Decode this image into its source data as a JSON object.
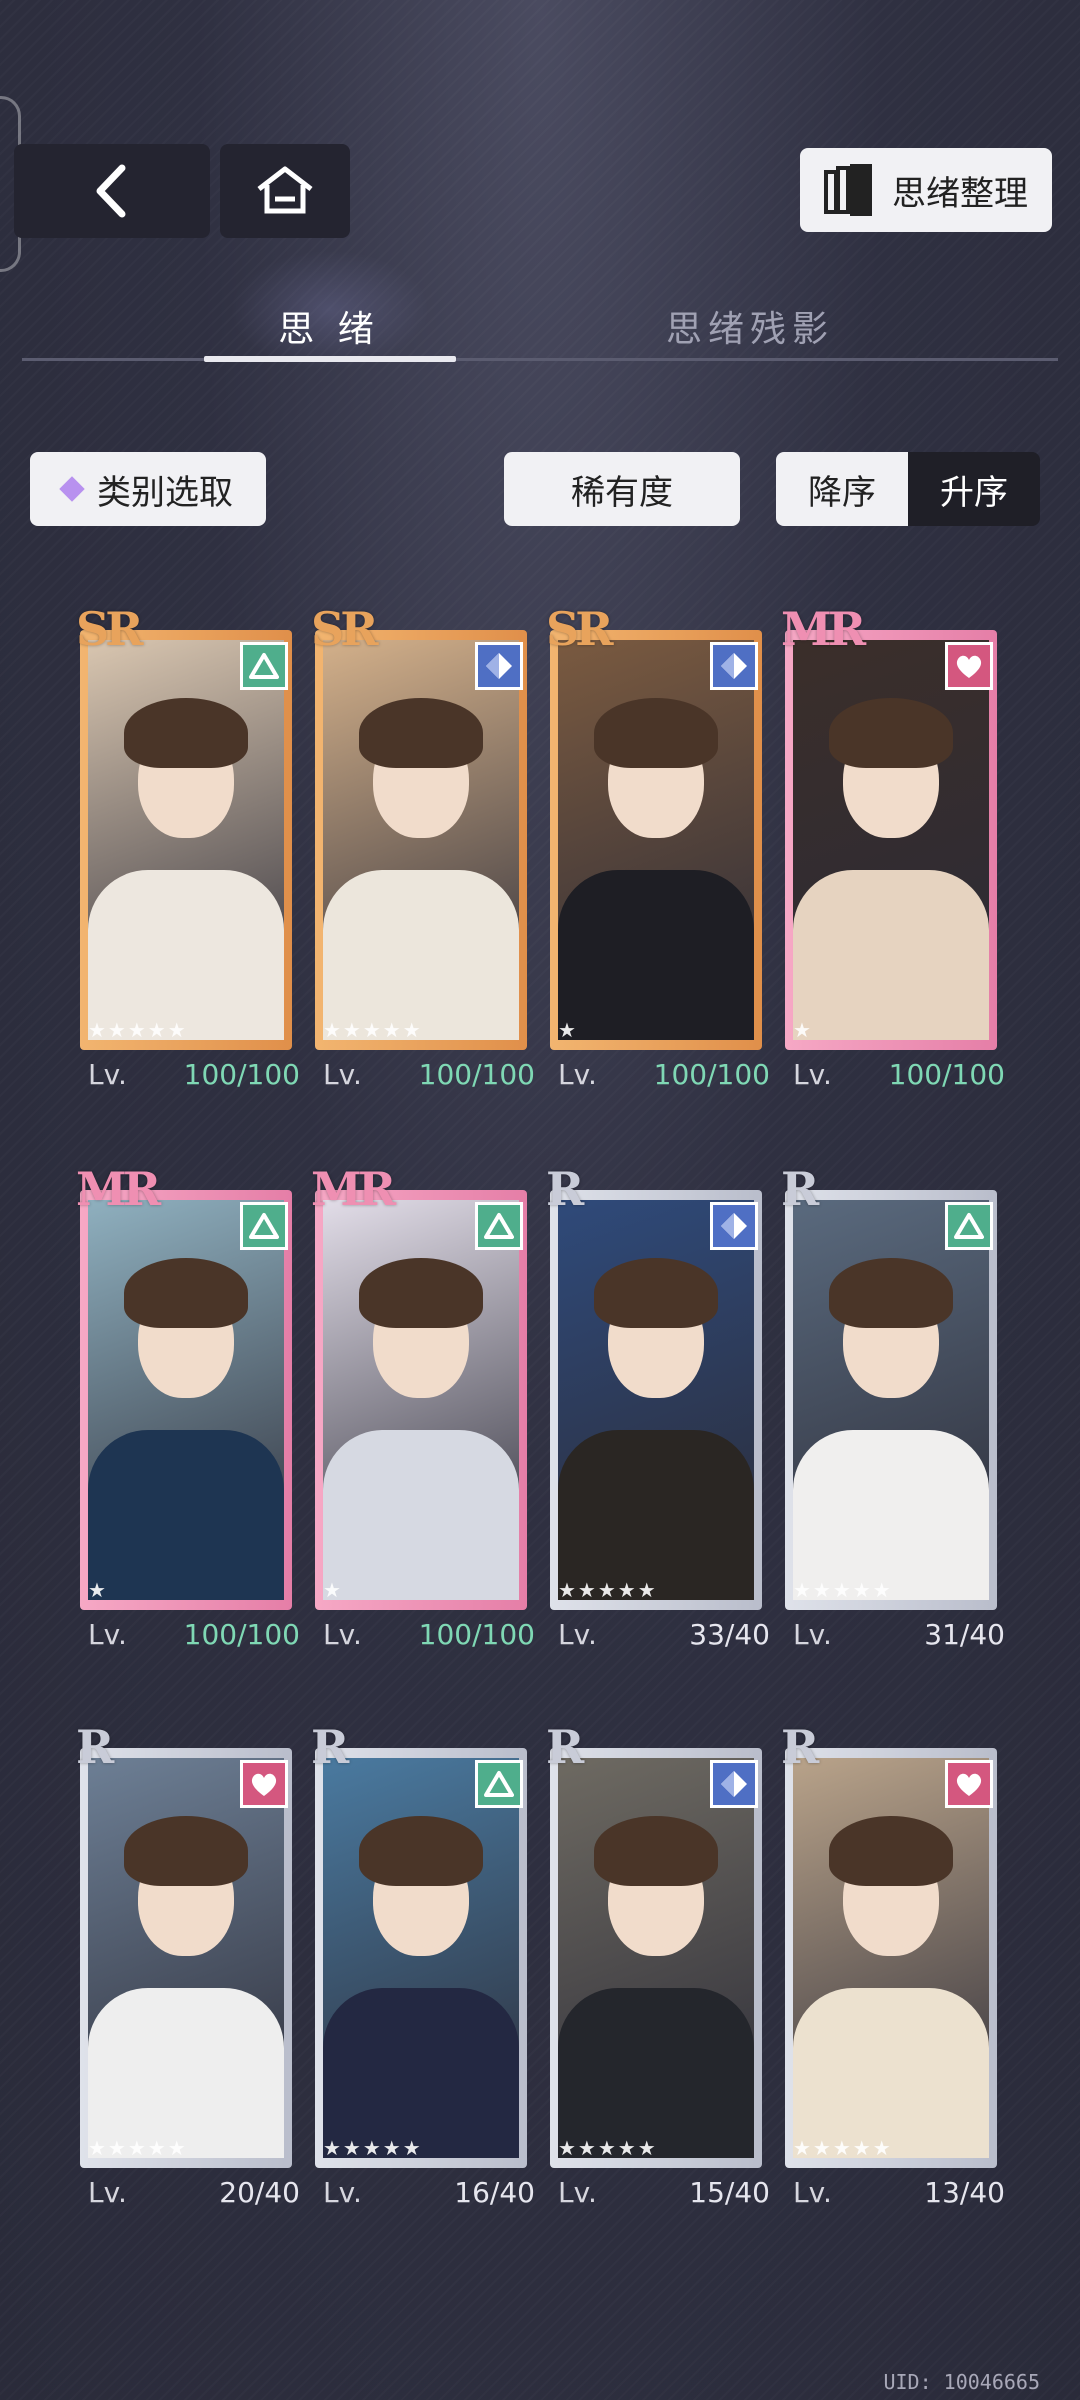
{
  "header": {
    "back_icon": "chevron-left-icon",
    "home_icon": "home-icon",
    "organize_label": "思绪整理",
    "organize_icon": "cards-stack-icon"
  },
  "tabs": [
    {
      "label": "思 绪",
      "active": true
    },
    {
      "label": "思绪残影",
      "active": false
    }
  ],
  "filters": {
    "category_label": "类别选取",
    "rarity_label": "稀有度",
    "sort_desc_label": "降序",
    "sort_asc_label": "升序",
    "sort_selected": "升序"
  },
  "colors": {
    "sr_gold": "#e8a35c",
    "mr_pink": "#ef8fb2",
    "r_silver": "#c9ccd8",
    "level_max_green": "#7fd8b4",
    "element_green": "#4fae8c",
    "element_blue": "#4f6fc4",
    "element_pink": "#d4577f"
  },
  "cards": [
    {
      "rarity": "SR",
      "element": "triangle-icon",
      "stars": "★★★★★",
      "lv_label": "Lv.",
      "level": "100/100",
      "maxed": true,
      "bg": "#d9c6b0",
      "outfit": "#ede7df"
    },
    {
      "rarity": "SR",
      "element": "diamond-icon",
      "stars": "★★★★★",
      "lv_label": "Lv.",
      "level": "100/100",
      "maxed": true,
      "bg": "#d3b08a",
      "outfit": "#ece6dc"
    },
    {
      "rarity": "SR",
      "element": "diamond-icon",
      "stars": "★",
      "lv_label": "Lv.",
      "level": "100/100",
      "maxed": true,
      "bg": "#7a5a40",
      "outfit": "#1e1e24"
    },
    {
      "rarity": "MR",
      "element": "heart-icon",
      "stars": "★",
      "lv_label": "Lv.",
      "level": "100/100",
      "maxed": true,
      "bg": "#3b2e2a",
      "outfit": "#e6d3c0"
    },
    {
      "rarity": "MR",
      "element": "triangle-icon",
      "stars": "★",
      "lv_label": "Lv.",
      "level": "100/100",
      "maxed": true,
      "bg": "#8fb0bf",
      "outfit": "#1e3552"
    },
    {
      "rarity": "MR",
      "element": "triangle-icon",
      "stars": "★",
      "lv_label": "Lv.",
      "level": "100/100",
      "maxed": true,
      "bg": "#e2dde8",
      "outfit": "#d6d9e2"
    },
    {
      "rarity": "R",
      "element": "diamond-icon",
      "stars": "★★★★★",
      "lv_label": "Lv.",
      "level": "33/40",
      "maxed": false,
      "bg": "#2f4a7a",
      "outfit": "#2a2623"
    },
    {
      "rarity": "R",
      "element": "triangle-icon",
      "stars": "★★★★★",
      "lv_label": "Lv.",
      "level": "31/40",
      "maxed": false,
      "bg": "#5a6a7e",
      "outfit": "#f0efee"
    },
    {
      "rarity": "R",
      "element": "heart-icon",
      "stars": "★★★★★",
      "lv_label": "Lv.",
      "level": "20/40",
      "maxed": false,
      "bg": "#6d7f95",
      "outfit": "#eeeeee"
    },
    {
      "rarity": "R",
      "element": "triangle-icon",
      "stars": "★★★★★",
      "lv_label": "Lv.",
      "level": "16/40",
      "maxed": false,
      "bg": "#4a7aa0",
      "outfit": "#232842"
    },
    {
      "rarity": "R",
      "element": "diamond-icon",
      "stars": "★★★★★",
      "lv_label": "Lv.",
      "level": "15/40",
      "maxed": false,
      "bg": "#6e6a62",
      "outfit": "#24262c"
    },
    {
      "rarity": "R",
      "element": "heart-icon",
      "stars": "★★★★★",
      "lv_label": "Lv.",
      "level": "13/40",
      "maxed": false,
      "bg": "#b9a38a",
      "outfit": "#ece1cf"
    }
  ],
  "footer": {
    "uid": "UID: 10046665"
  }
}
